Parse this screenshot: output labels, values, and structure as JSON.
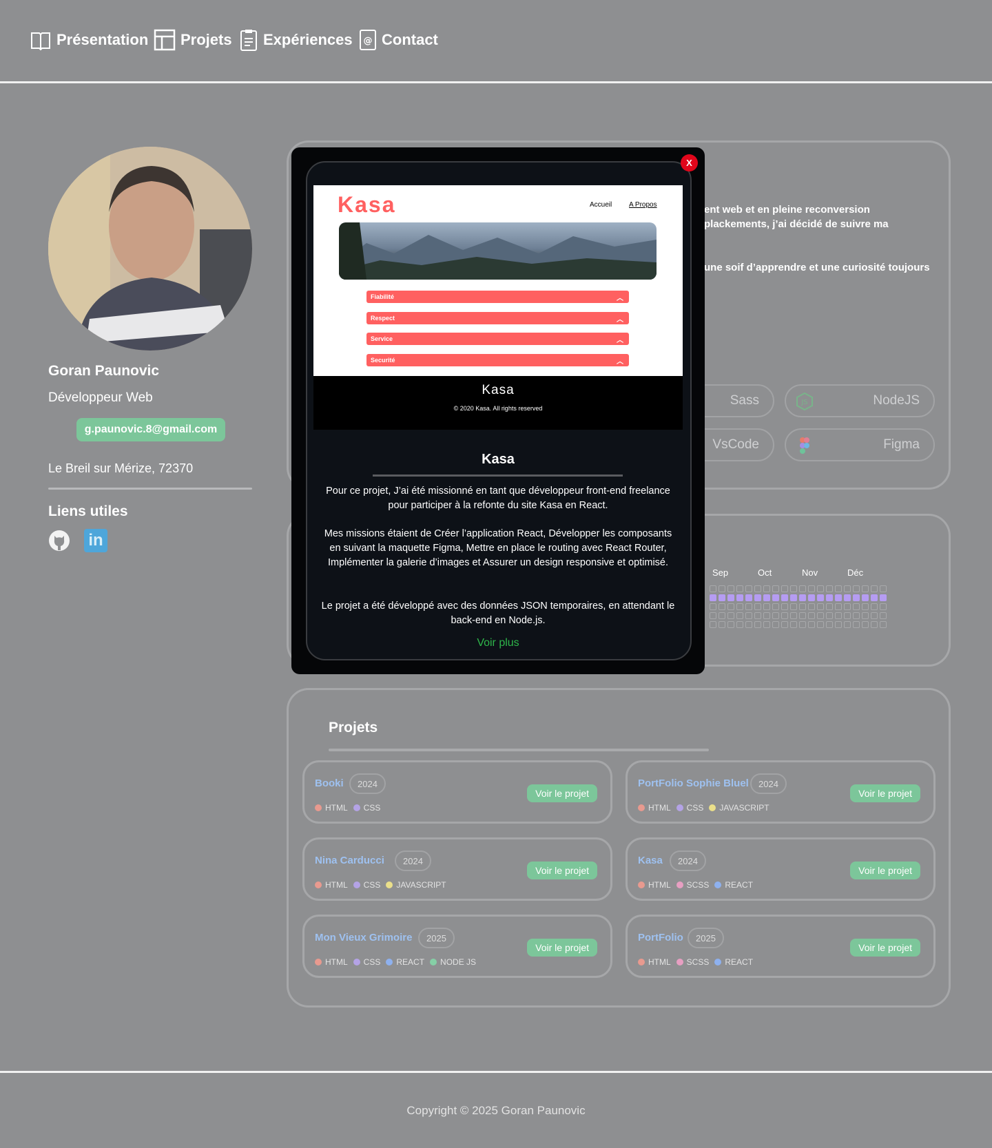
{
  "nav": {
    "items": [
      {
        "label": "Présentation",
        "icon": "book-icon"
      },
      {
        "label": "Projets",
        "icon": "layout-icon"
      },
      {
        "label": "Expériences",
        "icon": "clipboard-icon"
      },
      {
        "label": "Contact",
        "icon": "at-sign-icon"
      }
    ]
  },
  "profile": {
    "name": "Goran Paunovic",
    "role": "Développeur Web",
    "email": "g.paunovic.8@gmail.com",
    "address": "Le Breil sur Mérize, 72370",
    "links_title": "Liens utiles",
    "links": [
      {
        "icon": "github-icon"
      },
      {
        "icon": "linkedin-icon",
        "text": "in"
      }
    ]
  },
  "about": {
    "line1": "ent web et en pleine reconversion",
    "line2": "plackements, j’ai décidé de suivre ma",
    "line3": "une soif d’apprendre et une curiosité toujours"
  },
  "skills": [
    {
      "label": "Sass",
      "icon": ""
    },
    {
      "label": "NodeJS",
      "icon": "nodejs-icon"
    },
    {
      "label": "VsCode",
      "icon": ""
    },
    {
      "label": "Figma",
      "icon": "figma-icon"
    }
  ],
  "activity": {
    "months": [
      "Sep",
      "Oct",
      "Nov",
      "Déc"
    ]
  },
  "projects": {
    "title": "Projets",
    "button_label": "Voir le projet",
    "items": [
      {
        "title": "Booki",
        "year": "2024",
        "tags": [
          {
            "label": "HTML",
            "color": "#e89a8f"
          },
          {
            "label": "CSS",
            "color": "#b4a3e6"
          }
        ]
      },
      {
        "title": "PortFolio Sophie Bluel",
        "year": "2024",
        "tags": [
          {
            "label": "HTML",
            "color": "#e89a8f"
          },
          {
            "label": "CSS",
            "color": "#b4a3e6"
          },
          {
            "label": "JAVASCRIPT",
            "color": "#eadf8a"
          }
        ]
      },
      {
        "title": "Nina Carducci",
        "year": "2024",
        "tags": [
          {
            "label": "HTML",
            "color": "#e89a8f"
          },
          {
            "label": "CSS",
            "color": "#b4a3e6"
          },
          {
            "label": "JAVASCRIPT",
            "color": "#eadf8a"
          }
        ]
      },
      {
        "title": "Kasa",
        "year": "2024",
        "tags": [
          {
            "label": "HTML",
            "color": "#e89a8f"
          },
          {
            "label": "SCSS",
            "color": "#e79fc2"
          },
          {
            "label": "REACT",
            "color": "#8eb1ef"
          }
        ]
      },
      {
        "title": "Mon Vieux Grimoire",
        "year": "2025",
        "tags": [
          {
            "label": "HTML",
            "color": "#e89a8f"
          },
          {
            "label": "CSS",
            "color": "#b4a3e6"
          },
          {
            "label": "REACT",
            "color": "#8eb1ef"
          },
          {
            "label": "NODE JS",
            "color": "#85cfa6"
          }
        ]
      },
      {
        "title": "PortFolio",
        "year": "2025",
        "tags": [
          {
            "label": "HTML",
            "color": "#e89a8f"
          },
          {
            "label": "SCSS",
            "color": "#e79fc2"
          },
          {
            "label": "REACT",
            "color": "#8eb1ef"
          }
        ]
      }
    ]
  },
  "footer": {
    "copyright": "Copyright © 2025 Goran Paunovic"
  },
  "modal": {
    "close_label": "X",
    "screenshot": {
      "logo": "Kasa",
      "nav": [
        "Accueil",
        "A Propos"
      ],
      "accordions": [
        "Fiabilité",
        "Respect",
        "Service",
        "Securité"
      ],
      "footer_logo": "Kasa",
      "footer_copy": "© 2020 Kasa. All rights reserved"
    },
    "title": "Kasa",
    "p1": "Pour ce projet, J’ai été missionné en tant que développeur front-end freelance pour participer à la refonte du site Kasa en React.",
    "p2": "Mes missions étaient de Créer l’application React, Développer les composants en suivant la maquette Figma, Mettre en place le routing avec React Router, Implémenter la galerie d’images et Assurer un design responsive et optimisé.",
    "p3": "Le projet a été développé avec des données JSON temporaires, en attendant le back-end en Node.js.",
    "more": "Voir plus"
  }
}
